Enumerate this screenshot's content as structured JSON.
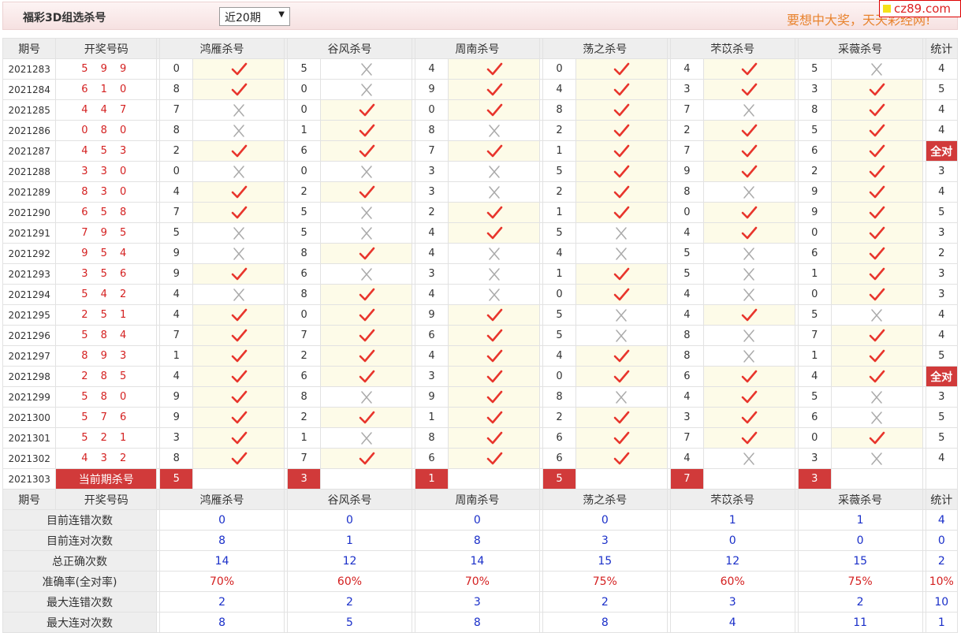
{
  "header": {
    "title": "福彩3D组选杀号",
    "period_select": "近20期",
    "slogan": "要想中大奖，天天彩经网!",
    "badge": "cz89.com"
  },
  "columns": {
    "period": "期号",
    "draw": "开奖号码",
    "experts": [
      "鸿雁杀号",
      "谷风杀号",
      "周南杀号",
      "荡之杀号",
      "芣苡杀号",
      "采薇杀号"
    ],
    "stat": "统计"
  },
  "rows": [
    {
      "period": "2021283",
      "draw": "5 9 9",
      "kills": [
        [
          "0",
          "hit"
        ],
        [
          "5",
          "miss"
        ],
        [
          "4",
          "hit"
        ],
        [
          "0",
          "hit"
        ],
        [
          "4",
          "hit"
        ],
        [
          "5",
          "miss"
        ]
      ],
      "stat": "4"
    },
    {
      "period": "2021284",
      "draw": "6 1 0",
      "kills": [
        [
          "8",
          "hit"
        ],
        [
          "0",
          "miss"
        ],
        [
          "9",
          "hit"
        ],
        [
          "4",
          "hit"
        ],
        [
          "3",
          "hit"
        ],
        [
          "3",
          "hit"
        ]
      ],
      "stat": "5"
    },
    {
      "period": "2021285",
      "draw": "4 4 7",
      "kills": [
        [
          "7",
          "miss"
        ],
        [
          "0",
          "hit"
        ],
        [
          "0",
          "hit"
        ],
        [
          "8",
          "hit"
        ],
        [
          "7",
          "miss"
        ],
        [
          "8",
          "hit"
        ]
      ],
      "stat": "4"
    },
    {
      "period": "2021286",
      "draw": "0 8 0",
      "kills": [
        [
          "8",
          "miss"
        ],
        [
          "1",
          "hit"
        ],
        [
          "8",
          "miss"
        ],
        [
          "2",
          "hit"
        ],
        [
          "2",
          "hit"
        ],
        [
          "5",
          "hit"
        ]
      ],
      "stat": "4"
    },
    {
      "period": "2021287",
      "draw": "4 5 3",
      "kills": [
        [
          "2",
          "hit"
        ],
        [
          "6",
          "hit"
        ],
        [
          "7",
          "hit"
        ],
        [
          "1",
          "hit"
        ],
        [
          "7",
          "hit"
        ],
        [
          "6",
          "hit"
        ]
      ],
      "stat": "全对"
    },
    {
      "period": "2021288",
      "draw": "3 3 0",
      "kills": [
        [
          "0",
          "miss"
        ],
        [
          "0",
          "miss"
        ],
        [
          "3",
          "miss"
        ],
        [
          "5",
          "hit"
        ],
        [
          "9",
          "hit"
        ],
        [
          "2",
          "hit"
        ]
      ],
      "stat": "3"
    },
    {
      "period": "2021289",
      "draw": "8 3 0",
      "kills": [
        [
          "4",
          "hit"
        ],
        [
          "2",
          "hit"
        ],
        [
          "3",
          "miss"
        ],
        [
          "2",
          "hit"
        ],
        [
          "8",
          "miss"
        ],
        [
          "9",
          "hit"
        ]
      ],
      "stat": "4"
    },
    {
      "period": "2021290",
      "draw": "6 5 8",
      "kills": [
        [
          "7",
          "hit"
        ],
        [
          "5",
          "miss"
        ],
        [
          "2",
          "hit"
        ],
        [
          "1",
          "hit"
        ],
        [
          "0",
          "hit"
        ],
        [
          "9",
          "hit"
        ]
      ],
      "stat": "5"
    },
    {
      "period": "2021291",
      "draw": "7 9 5",
      "kills": [
        [
          "5",
          "miss"
        ],
        [
          "5",
          "miss"
        ],
        [
          "4",
          "hit"
        ],
        [
          "5",
          "miss"
        ],
        [
          "4",
          "hit"
        ],
        [
          "0",
          "hit"
        ]
      ],
      "stat": "3"
    },
    {
      "period": "2021292",
      "draw": "9 5 4",
      "kills": [
        [
          "9",
          "miss"
        ],
        [
          "8",
          "hit"
        ],
        [
          "4",
          "miss"
        ],
        [
          "4",
          "miss"
        ],
        [
          "5",
          "miss"
        ],
        [
          "6",
          "hit"
        ]
      ],
      "stat": "2"
    },
    {
      "period": "2021293",
      "draw": "3 5 6",
      "kills": [
        [
          "9",
          "hit"
        ],
        [
          "6",
          "miss"
        ],
        [
          "3",
          "miss"
        ],
        [
          "1",
          "hit"
        ],
        [
          "5",
          "miss"
        ],
        [
          "1",
          "hit"
        ]
      ],
      "stat": "3"
    },
    {
      "period": "2021294",
      "draw": "5 4 2",
      "kills": [
        [
          "4",
          "miss"
        ],
        [
          "8",
          "hit"
        ],
        [
          "4",
          "miss"
        ],
        [
          "0",
          "hit"
        ],
        [
          "4",
          "miss"
        ],
        [
          "0",
          "hit"
        ]
      ],
      "stat": "3"
    },
    {
      "period": "2021295",
      "draw": "2 5 1",
      "kills": [
        [
          "4",
          "hit"
        ],
        [
          "0",
          "hit"
        ],
        [
          "9",
          "hit"
        ],
        [
          "5",
          "miss"
        ],
        [
          "4",
          "hit"
        ],
        [
          "5",
          "miss"
        ]
      ],
      "stat": "4"
    },
    {
      "period": "2021296",
      "draw": "5 8 4",
      "kills": [
        [
          "7",
          "hit"
        ],
        [
          "7",
          "hit"
        ],
        [
          "6",
          "hit"
        ],
        [
          "5",
          "miss"
        ],
        [
          "8",
          "miss"
        ],
        [
          "7",
          "hit"
        ]
      ],
      "stat": "4"
    },
    {
      "period": "2021297",
      "draw": "8 9 3",
      "kills": [
        [
          "1",
          "hit"
        ],
        [
          "2",
          "hit"
        ],
        [
          "4",
          "hit"
        ],
        [
          "4",
          "hit"
        ],
        [
          "8",
          "miss"
        ],
        [
          "1",
          "hit"
        ]
      ],
      "stat": "5"
    },
    {
      "period": "2021298",
      "draw": "2 8 5",
      "kills": [
        [
          "4",
          "hit"
        ],
        [
          "6",
          "hit"
        ],
        [
          "3",
          "hit"
        ],
        [
          "0",
          "hit"
        ],
        [
          "6",
          "hit"
        ],
        [
          "4",
          "hit"
        ]
      ],
      "stat": "全对"
    },
    {
      "period": "2021299",
      "draw": "5 8 0",
      "kills": [
        [
          "9",
          "hit"
        ],
        [
          "8",
          "miss"
        ],
        [
          "9",
          "hit"
        ],
        [
          "8",
          "miss"
        ],
        [
          "4",
          "hit"
        ],
        [
          "5",
          "miss"
        ]
      ],
      "stat": "3"
    },
    {
      "period": "2021300",
      "draw": "5 7 6",
      "kills": [
        [
          "9",
          "hit"
        ],
        [
          "2",
          "hit"
        ],
        [
          "1",
          "hit"
        ],
        [
          "2",
          "hit"
        ],
        [
          "3",
          "hit"
        ],
        [
          "6",
          "miss"
        ]
      ],
      "stat": "5"
    },
    {
      "period": "2021301",
      "draw": "5 2 1",
      "kills": [
        [
          "3",
          "hit"
        ],
        [
          "1",
          "miss"
        ],
        [
          "8",
          "hit"
        ],
        [
          "6",
          "hit"
        ],
        [
          "7",
          "hit"
        ],
        [
          "0",
          "hit"
        ]
      ],
      "stat": "5"
    },
    {
      "period": "2021302",
      "draw": "4 3 2",
      "kills": [
        [
          "8",
          "hit"
        ],
        [
          "7",
          "hit"
        ],
        [
          "6",
          "hit"
        ],
        [
          "6",
          "hit"
        ],
        [
          "4",
          "miss"
        ],
        [
          "3",
          "miss"
        ]
      ],
      "stat": "4"
    }
  ],
  "current": {
    "period": "2021303",
    "label": "当前期杀号",
    "kills": [
      "5",
      "3",
      "1",
      "5",
      "7",
      "3"
    ]
  },
  "summary": [
    {
      "label": "目前连错次数",
      "values": [
        "0",
        "0",
        "0",
        "0",
        "1",
        "1"
      ],
      "stat": "4"
    },
    {
      "label": "目前连对次数",
      "values": [
        "8",
        "1",
        "8",
        "3",
        "0",
        "0"
      ],
      "stat": "0"
    },
    {
      "label": "总正确次数",
      "values": [
        "14",
        "12",
        "14",
        "15",
        "12",
        "15"
      ],
      "stat": "2"
    },
    {
      "label": "准确率(全对率)",
      "values": [
        "70%",
        "60%",
        "70%",
        "75%",
        "60%",
        "75%"
      ],
      "stat": "10%",
      "rate": true
    },
    {
      "label": "最大连错次数",
      "values": [
        "2",
        "2",
        "3",
        "2",
        "3",
        "2"
      ],
      "stat": "10"
    },
    {
      "label": "最大连对次数",
      "values": [
        "8",
        "5",
        "8",
        "8",
        "4",
        "11"
      ],
      "stat": "1"
    }
  ],
  "colors": {
    "hit": "#e8352c",
    "miss": "#aaaaaa",
    "highlight": "#d13a3a",
    "summary_value": "#1a2fc9"
  },
  "icons": {
    "hit": "check-icon",
    "miss": "cross-icon"
  }
}
